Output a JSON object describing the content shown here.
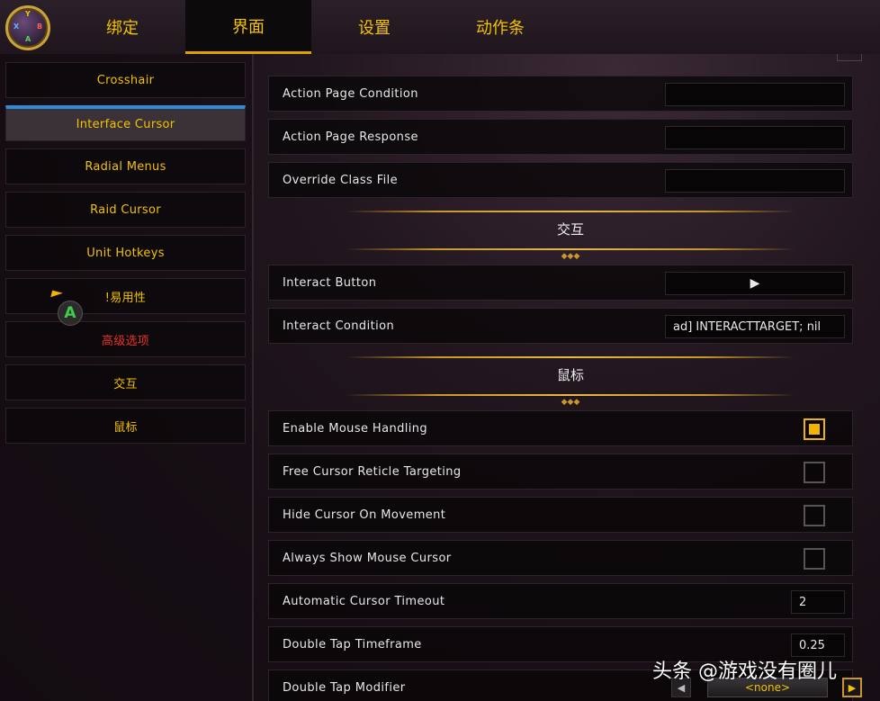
{
  "top_nav": {
    "logo_letters": {
      "y": "Y",
      "x": "X",
      "b": "B",
      "a": "A"
    },
    "tabs": [
      {
        "label": "绑定",
        "active": false
      },
      {
        "label": "界面",
        "active": true
      },
      {
        "label": "设置",
        "active": false
      },
      {
        "label": "动作条",
        "active": false
      }
    ]
  },
  "sidebar": {
    "items": [
      {
        "label": "Crosshair"
      },
      {
        "label": "Interface Cursor",
        "active": true
      },
      {
        "label": "Radial Menus"
      },
      {
        "label": "Raid Cursor"
      },
      {
        "label": "Unit Hotkeys"
      },
      {
        "label": "!易用性"
      },
      {
        "label": "高级选项",
        "color": "#e8322a"
      },
      {
        "label": "交互"
      },
      {
        "label": "鼠标"
      }
    ],
    "cursor_button": "A"
  },
  "settings": {
    "action_page_condition": {
      "label": "Action Page Condition",
      "value": ""
    },
    "action_page_response": {
      "label": "Action Page Response",
      "value": ""
    },
    "override_class_file": {
      "label": "Override Class File",
      "value": ""
    },
    "section_interact": {
      "title": "交互"
    },
    "interact_button": {
      "label": "Interact Button",
      "value": "▶"
    },
    "interact_condition": {
      "label": "Interact Condition",
      "value": "ad] INTERACTTARGET; nil"
    },
    "section_mouse": {
      "title": "鼠标"
    },
    "enable_mouse_handling": {
      "label": "Enable Mouse Handling",
      "checked": true
    },
    "free_cursor_reticle": {
      "label": "Free Cursor Reticle Targeting",
      "checked": false
    },
    "hide_cursor_on_movement": {
      "label": "Hide Cursor On Movement",
      "checked": false
    },
    "always_show_mouse_cursor": {
      "label": "Always Show Mouse Cursor",
      "checked": false
    },
    "automatic_cursor_timeout": {
      "label": "Automatic Cursor Timeout",
      "value": "2"
    },
    "double_tap_timeframe": {
      "label": "Double Tap Timeframe",
      "value": "0.25"
    },
    "double_tap_modifier": {
      "label": "Double Tap Modifier",
      "value": "<none>",
      "prev": "◀",
      "next": "▶"
    }
  },
  "watermark": "头条 @游戏没有圈儿",
  "colors": {
    "accent": "#f2c200",
    "active_tab_underline": "#e0a000",
    "active_side_bar": "#2f8ad8",
    "checkbox_on": "#f2b400",
    "danger": "#e8322a"
  }
}
